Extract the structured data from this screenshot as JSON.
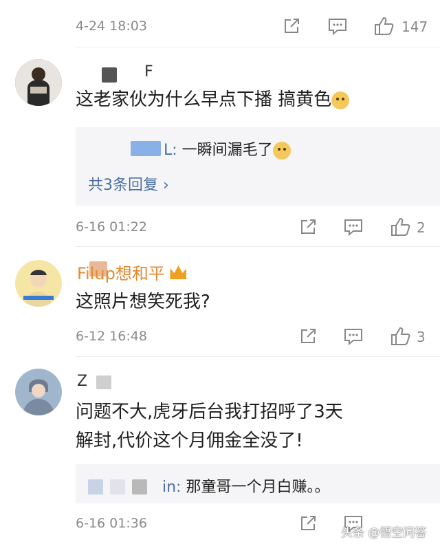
{
  "header": {
    "time": "4-24 18:03",
    "likes": "147"
  },
  "comments": [
    {
      "username_visible": "F",
      "text": "这老家伙为什么早点下播 搞黄色",
      "reply": {
        "suffix": "L:",
        "text": "一瞬间漏毛了"
      },
      "more_replies": "共3条回复 ›",
      "time": "6-16 01:22",
      "likes": "2"
    },
    {
      "username_visible": "Filup想和平",
      "text": "这照片想笑死我?",
      "time": "6-12 16:48",
      "likes": "3"
    },
    {
      "username_visible": "Z",
      "text_line1": "问题不大,虎牙后台我打招呼了3天",
      "text_line2": "解封,代价这个月佣金全没了!",
      "reply": {
        "suffix": "in:",
        "text": "那童哥一个月白赚。。"
      },
      "time": "6-16 01:36"
    }
  ],
  "watermark": "头条 @悟空问答",
  "colors": {
    "link": "#4a6fa5",
    "meta": "#8a8a8a",
    "reply_bg": "#f5f5f7",
    "crown": "#f0a020"
  }
}
